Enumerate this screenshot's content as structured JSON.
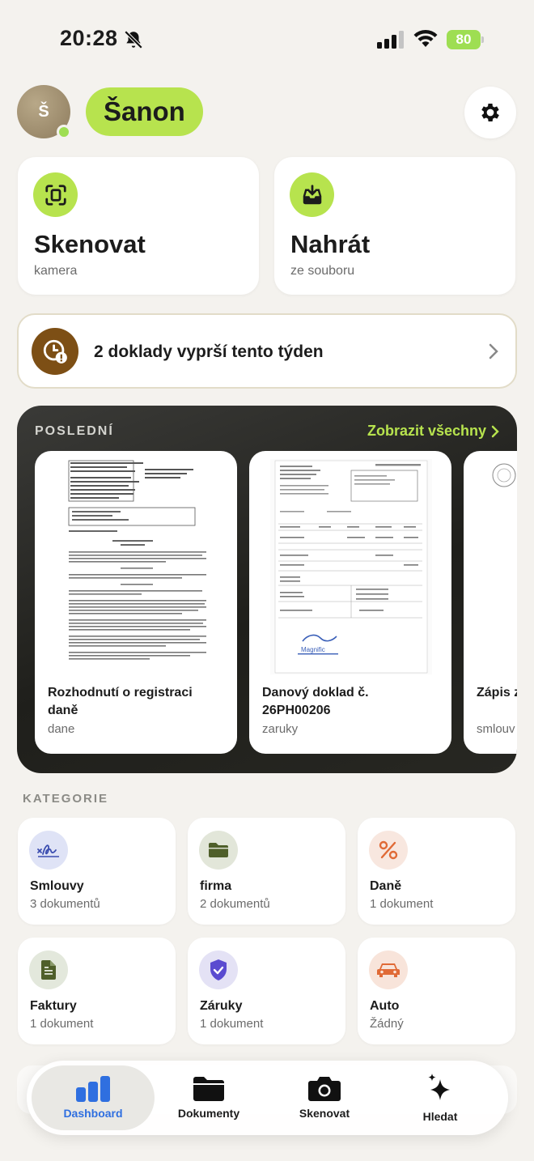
{
  "status_bar": {
    "time": "20:28",
    "battery": "80"
  },
  "header": {
    "avatar_initial": "Š",
    "app_name": "Šanon"
  },
  "actions": [
    {
      "title": "Skenovat",
      "subtitle": "kamera"
    },
    {
      "title": "Nahrát",
      "subtitle": "ze souboru"
    }
  ],
  "alert": {
    "text": "2 doklady vyprší tento týden"
  },
  "recent": {
    "header": "POSLEDNÍ",
    "show_all": "Zobrazit všechny",
    "documents": [
      {
        "title": "Rozhodnutí o registraci daně",
        "category": "dane"
      },
      {
        "title": "Danový doklad č. 26PH00206",
        "category": "zaruky"
      },
      {
        "title": "Zápis z zastup",
        "category": "smlouv"
      }
    ]
  },
  "categories": {
    "header": "KATEGORIE",
    "items": [
      {
        "name": "Smlouvy",
        "count": "3 dokumentů",
        "icon": "signature-icon",
        "color": "#dfe3f6"
      },
      {
        "name": "firma",
        "count": "2 dokumentů",
        "icon": "folder-icon",
        "color": "#e2e6d9"
      },
      {
        "name": "Daně",
        "count": "1 dokument",
        "icon": "percent-icon",
        "color": "#f8e7df"
      },
      {
        "name": "Faktury",
        "count": "1 dokument",
        "icon": "invoice-icon",
        "color": "#e3e8dc"
      },
      {
        "name": "Záruky",
        "count": "1 dokument",
        "icon": "shield-check-icon",
        "color": "#e4e2f5"
      },
      {
        "name": "Auto",
        "count": "Žádný",
        "icon": "car-icon",
        "color": "#f8e4da"
      }
    ]
  },
  "nav": {
    "items": [
      {
        "label": "Dashboard"
      },
      {
        "label": "Dokumenty"
      },
      {
        "label": "Skenovat"
      },
      {
        "label": "Hledat"
      }
    ]
  },
  "colors": {
    "accent": "#b7e34e",
    "link_blue": "#2f6fe0",
    "warning_brown": "#7d4f15"
  }
}
